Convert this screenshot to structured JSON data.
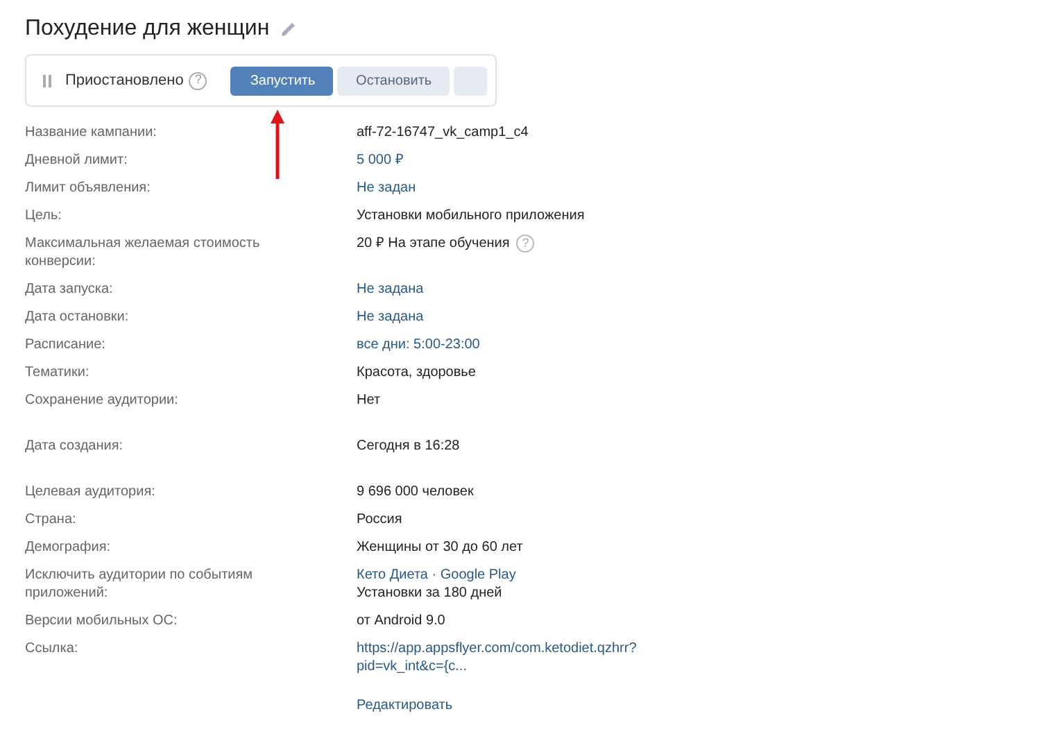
{
  "title": "Похудение для женщин",
  "status": {
    "label": "Приостановлено",
    "paused": true,
    "help": "?"
  },
  "buttons": [
    {
      "label": "Запустить",
      "kind": "primary"
    },
    {
      "label": "Остановить",
      "kind": "secondary"
    },
    {
      "kind": "blank"
    }
  ],
  "sections": [
    {
      "rows": [
        {
          "label": "Название кампании:",
          "values": [
            {
              "text": "aff-72-16747_vk_camp1_c4",
              "kind": "text"
            }
          ]
        },
        {
          "label": "Дневной лимит:",
          "values": [
            {
              "text": "5 000 ₽",
              "kind": "link"
            }
          ]
        },
        {
          "label": "Лимит объявления:",
          "values": [
            {
              "text": "Не задан",
              "kind": "link"
            }
          ]
        },
        {
          "label": "Цель:",
          "values": [
            {
              "text": "Установки мобильного приложения",
              "kind": "text"
            }
          ]
        },
        {
          "label": "Максимальная желаемая стоимость конверсии:",
          "values": [
            {
              "text": "20 ₽ На этапе обучения",
              "kind": "text",
              "help": "?"
            }
          ]
        },
        {
          "label": "Дата запуска:",
          "values": [
            {
              "text": "Не задана",
              "kind": "link"
            }
          ]
        },
        {
          "label": "Дата остановки:",
          "values": [
            {
              "text": "Не задана",
              "kind": "link"
            }
          ]
        },
        {
          "label": "Расписание:",
          "values": [
            {
              "text": "все дни: 5:00-23:00",
              "kind": "link"
            }
          ]
        },
        {
          "label": "Тематики:",
          "values": [
            {
              "text": "Красота, здоровье",
              "kind": "text"
            }
          ]
        },
        {
          "label": "Сохранение аудитории:",
          "values": [
            {
              "text": "Нет",
              "kind": "text"
            }
          ]
        }
      ]
    },
    {
      "rows": [
        {
          "label": "Дата создания:",
          "values": [
            {
              "text": "Сегодня в 16:28",
              "kind": "text"
            }
          ]
        }
      ]
    },
    {
      "rows": [
        {
          "label": "Целевая аудитория:",
          "values": [
            {
              "text": "9 696 000 человек",
              "kind": "text"
            }
          ]
        },
        {
          "label": "Страна:",
          "values": [
            {
              "text": "Россия",
              "kind": "text"
            }
          ]
        },
        {
          "label": "Демография:",
          "values": [
            {
              "text": "Женщины от 30 до 60 лет",
              "kind": "text"
            }
          ]
        },
        {
          "label": "Исключить аудитории по событиям приложений:",
          "values": [
            {
              "text": "Кето Диета · Google Play",
              "kind": "link"
            },
            {
              "text": "Установки за 180 дней",
              "kind": "text"
            }
          ]
        },
        {
          "label": "Версии мобильных ОС:",
          "values": [
            {
              "text": "от Android 9.0",
              "kind": "text"
            }
          ]
        },
        {
          "label": "Ссылка:",
          "values": [
            {
              "text": "https://app.appsflyer.com/com.ketodiet.qzhrr?pid=vk_int&c={c...",
              "kind": "link"
            }
          ]
        }
      ]
    }
  ],
  "edit_link": "Редактировать"
}
